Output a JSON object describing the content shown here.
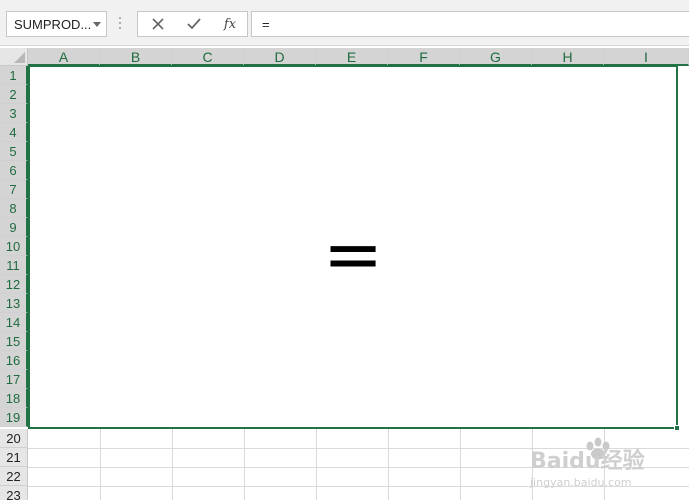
{
  "name_box": {
    "value": "SUMPROD..."
  },
  "formula_bar": {
    "cancel_icon": "close-icon",
    "enter_icon": "check-icon",
    "fx_label": "fx",
    "formula_text": "="
  },
  "columns": [
    "A",
    "B",
    "C",
    "D",
    "E",
    "F",
    "G",
    "H",
    "I"
  ],
  "rows": [
    "1",
    "2",
    "3",
    "4",
    "5",
    "6",
    "7",
    "8",
    "9",
    "10",
    "11",
    "12",
    "13",
    "14",
    "15",
    "16",
    "17",
    "18",
    "19",
    "20",
    "21",
    "22",
    "23"
  ],
  "selection": {
    "range_columns": [
      "A",
      "B",
      "C",
      "D",
      "E",
      "F",
      "G",
      "H",
      "I"
    ],
    "range_rows_first": 1,
    "range_rows_last": 19
  },
  "active_cell": {
    "content": "="
  },
  "watermark": {
    "brand": "Baidu经验",
    "url": "jingyan.baidu.com"
  },
  "colors": {
    "accent": "#217346",
    "header_bg": "#e6e6e6",
    "header_sel_bg": "#d4d4d4"
  }
}
